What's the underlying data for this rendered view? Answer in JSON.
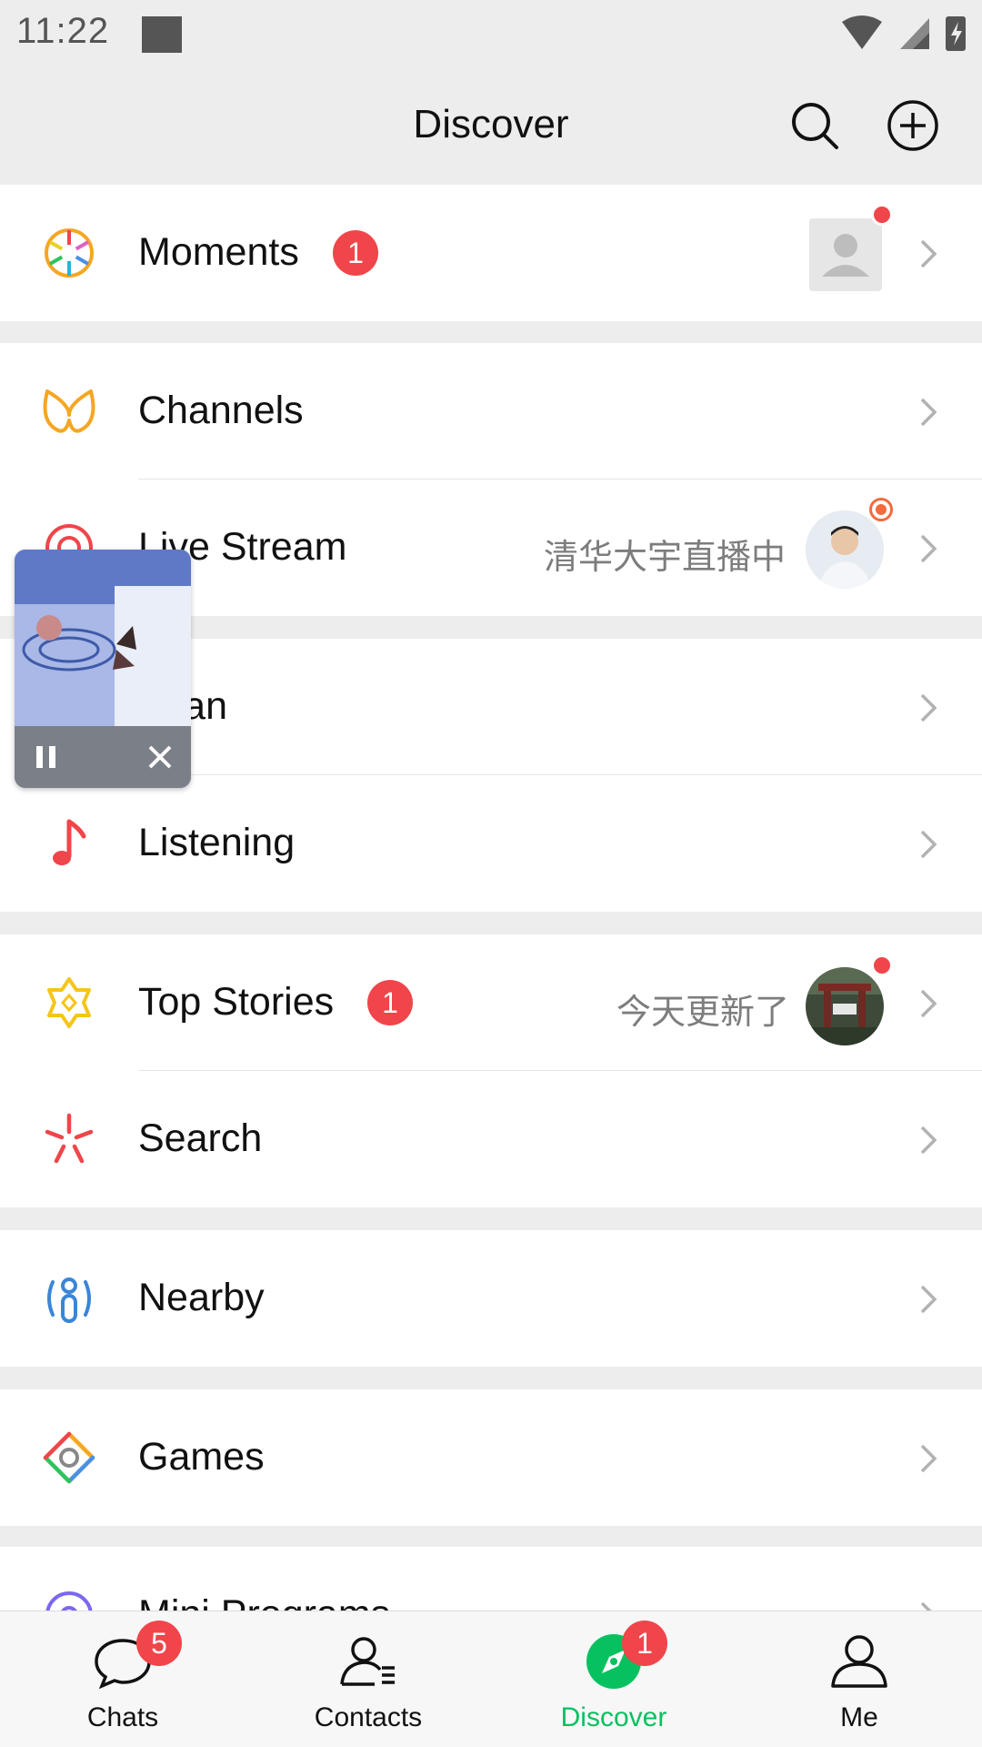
{
  "status_bar": {
    "time": "11:22"
  },
  "header": {
    "title": "Discover"
  },
  "rows": {
    "moments": {
      "label": "Moments",
      "badge": "1"
    },
    "channels": {
      "label": "Channels"
    },
    "live_stream": {
      "label": "Live Stream",
      "right_text": "清华大宇直播中"
    },
    "scan": {
      "label": "Scan"
    },
    "listening": {
      "label": "Listening"
    },
    "top_stories": {
      "label": "Top Stories",
      "badge": "1",
      "right_text": "今天更新了"
    },
    "search": {
      "label": "Search"
    },
    "nearby": {
      "label": "Nearby"
    },
    "games": {
      "label": "Games"
    },
    "mini_programs": {
      "label": "Mini Programs"
    }
  },
  "bottom_nav": [
    {
      "label": "Chats",
      "badge": "5",
      "icon": "chat-bubble-icon"
    },
    {
      "label": "Contacts",
      "icon": "contacts-icon"
    },
    {
      "label": "Discover",
      "badge": "1",
      "icon": "compass-icon",
      "active": true
    },
    {
      "label": "Me",
      "icon": "person-icon"
    }
  ],
  "colors": {
    "accent_green": "#07c160",
    "badge_red": "#f0454a",
    "background": "#ededed"
  }
}
